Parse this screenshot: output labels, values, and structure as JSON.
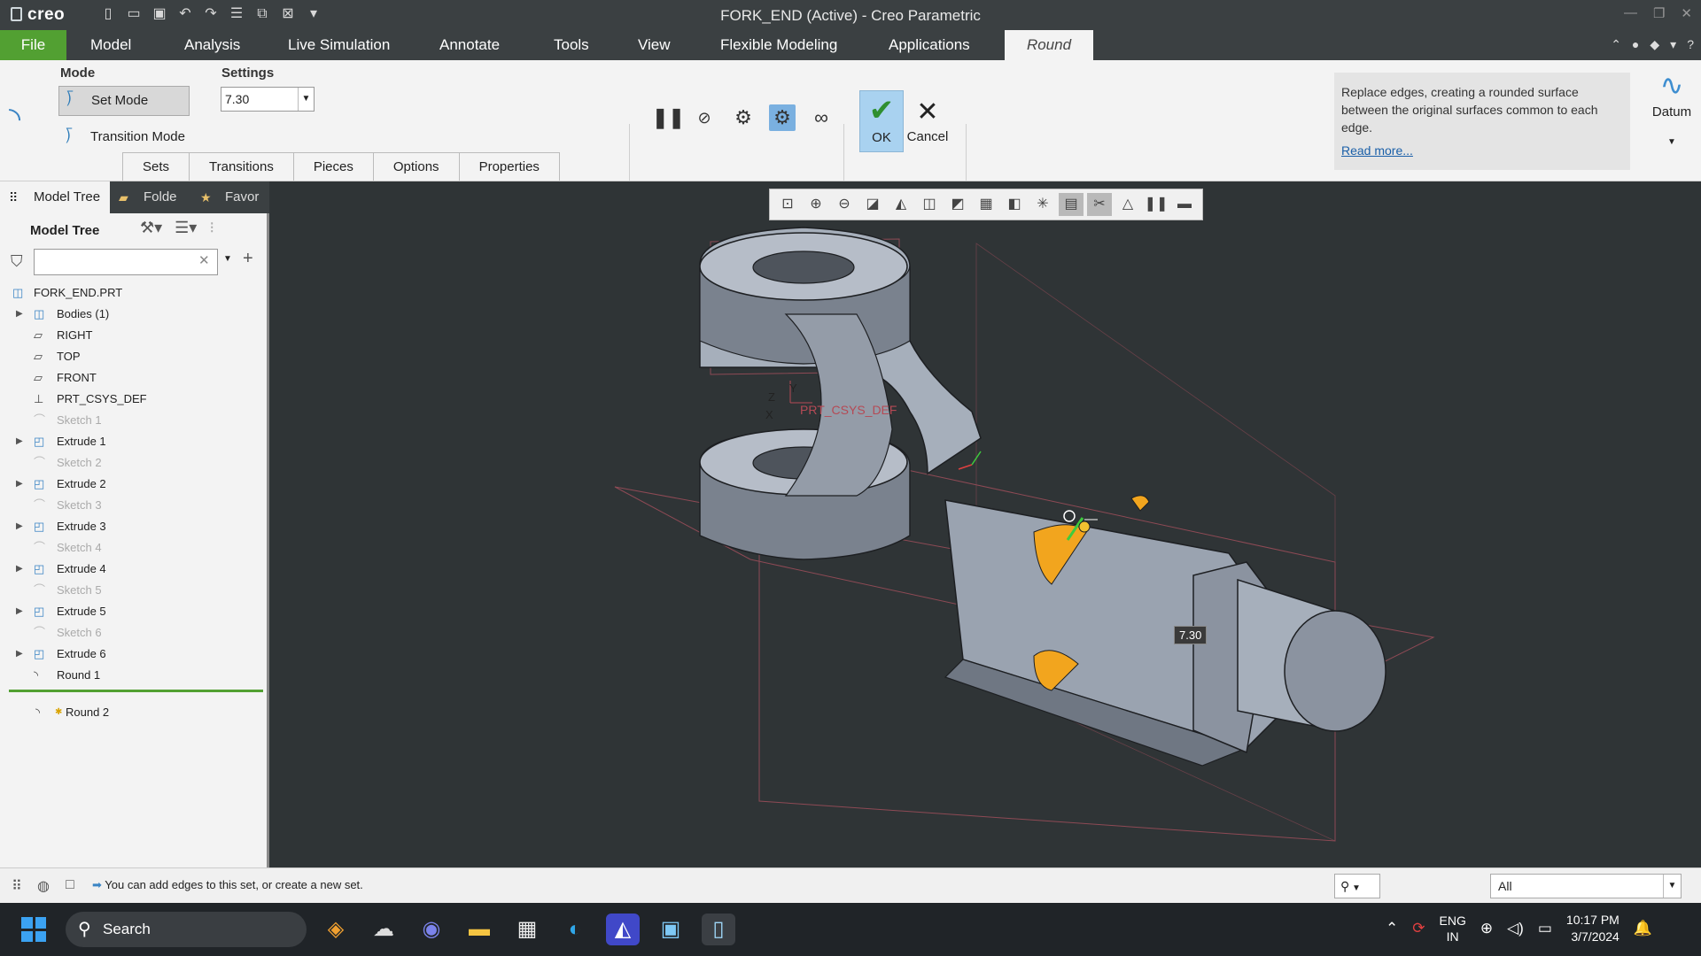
{
  "title": "FORK_END (Active) - Creo Parametric",
  "app_name": "creo",
  "menu": [
    "File",
    "Model",
    "Analysis",
    "Live Simulation",
    "Annotate",
    "Tools",
    "View",
    "Flexible Modeling",
    "Applications",
    "Round"
  ],
  "ribbon": {
    "mode_label": "Mode",
    "set_mode": "Set Mode",
    "transition_mode": "Transition Mode",
    "settings_label": "Settings",
    "radius_value": "7.30",
    "tabs": [
      "Sets",
      "Transitions",
      "Pieces",
      "Options",
      "Properties"
    ],
    "ok_label": "OK",
    "cancel_label": "Cancel",
    "help_text": "Replace edges, creating a rounded surface between the original surfaces common to each edge.",
    "help_link": "Read more...",
    "datum_label": "Datum"
  },
  "left_tabs": [
    "Model Tree",
    "Folde",
    "Favor"
  ],
  "model_tree": {
    "header": "Model Tree",
    "filter_placeholder": "",
    "items": [
      {
        "label": "FORK_END.PRT",
        "icon": "part-icon",
        "expand": false,
        "dim": false
      },
      {
        "label": "Bodies (1)",
        "icon": "bodies-icon",
        "expand": true,
        "dim": false
      },
      {
        "label": "RIGHT",
        "icon": "datum-plane-icon",
        "expand": false,
        "dim": false
      },
      {
        "label": "TOP",
        "icon": "datum-plane-icon",
        "expand": false,
        "dim": false
      },
      {
        "label": "FRONT",
        "icon": "datum-plane-icon",
        "expand": false,
        "dim": false
      },
      {
        "label": "PRT_CSYS_DEF",
        "icon": "csys-icon",
        "expand": false,
        "dim": false
      },
      {
        "label": "Sketch 1",
        "icon": "sketch-icon",
        "expand": false,
        "dim": true
      },
      {
        "label": "Extrude 1",
        "icon": "extrude-icon",
        "expand": true,
        "dim": false
      },
      {
        "label": "Sketch 2",
        "icon": "sketch-icon",
        "expand": false,
        "dim": true
      },
      {
        "label": "Extrude 2",
        "icon": "extrude-icon",
        "expand": true,
        "dim": false
      },
      {
        "label": "Sketch 3",
        "icon": "sketch-icon",
        "expand": false,
        "dim": true
      },
      {
        "label": "Extrude 3",
        "icon": "extrude-icon",
        "expand": true,
        "dim": false
      },
      {
        "label": "Sketch 4",
        "icon": "sketch-icon",
        "expand": false,
        "dim": true
      },
      {
        "label": "Extrude 4",
        "icon": "extrude-icon",
        "expand": true,
        "dim": false
      },
      {
        "label": "Sketch 5",
        "icon": "sketch-icon",
        "expand": false,
        "dim": true
      },
      {
        "label": "Extrude 5",
        "icon": "extrude-icon",
        "expand": true,
        "dim": false
      },
      {
        "label": "Sketch 6",
        "icon": "sketch-icon",
        "expand": false,
        "dim": true
      },
      {
        "label": "Extrude 6",
        "icon": "extrude-icon",
        "expand": true,
        "dim": false
      },
      {
        "label": "Round 1",
        "icon": "round-icon",
        "expand": false,
        "dim": false
      }
    ],
    "active_feature": "Round 2"
  },
  "viewport": {
    "csys_label": "PRT_CSYS_DEF",
    "axis_x": "X",
    "axis_y": "Y",
    "axis_z": "Z",
    "dimension": "7.30"
  },
  "status": {
    "message": "You can add edges to this set, or create a new set.",
    "filter_value": "All"
  },
  "taskbar": {
    "search": "Search",
    "lang1": "ENG",
    "lang2": "IN",
    "time": "10:17 PM",
    "date": "3/7/2024"
  },
  "colors": {
    "accent_green": "#52a032",
    "chrome_dark": "#3b4042",
    "model_gray": "#a9b1bd",
    "round_orange": "#f2a51e"
  }
}
